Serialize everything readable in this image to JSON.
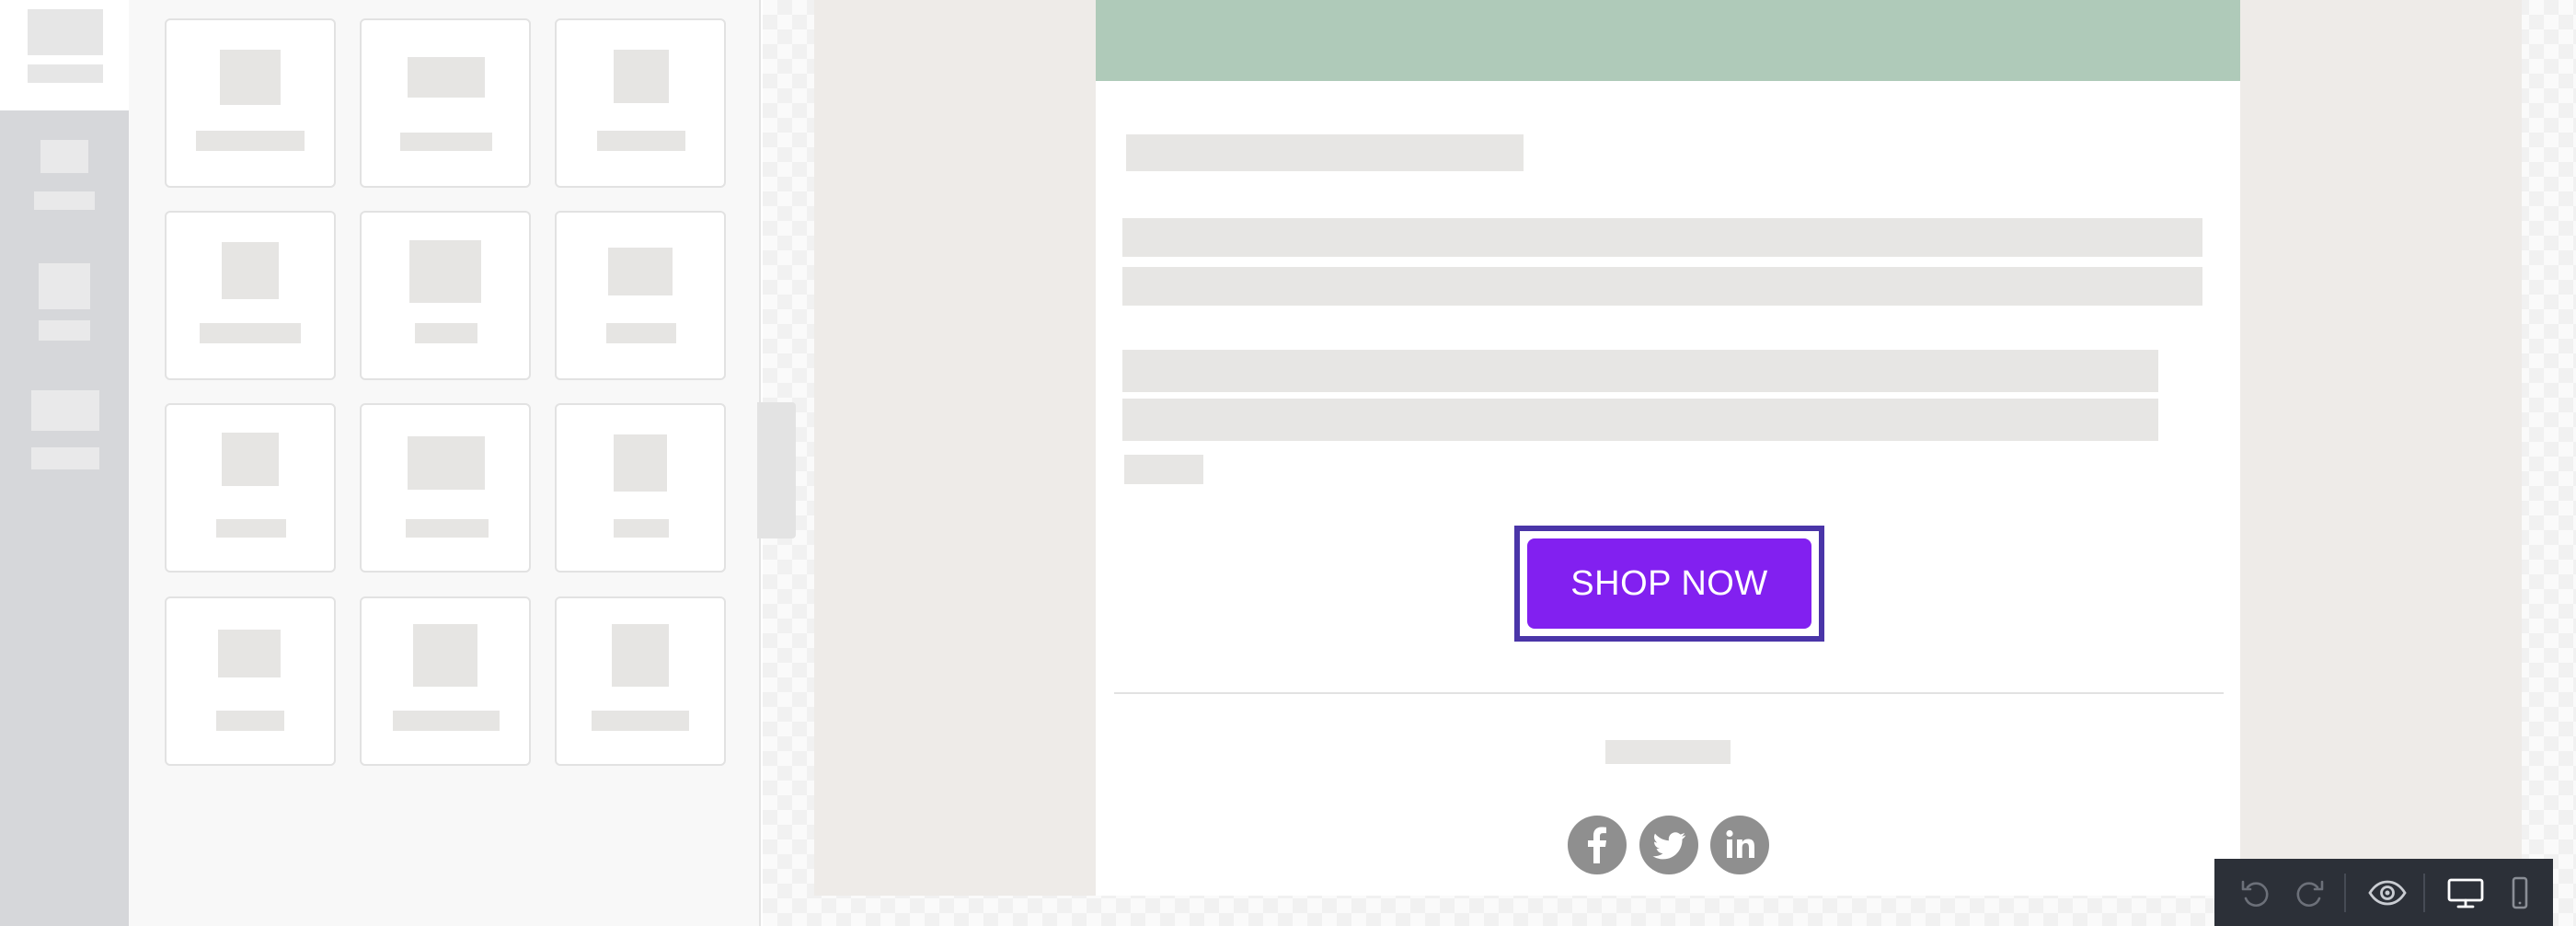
{
  "editor": {
    "sidebar_tabs": [
      "content-blocks",
      "rows",
      "settings",
      "saved-blocks"
    ],
    "active_tab": "content-blocks",
    "content_block_tile_count": 12
  },
  "email": {
    "header_color": "#afcab9",
    "cta": {
      "label": "SHOP NOW",
      "background": "#8220f0",
      "text_color": "#ffffff",
      "selected_outline": "#4a35a8"
    },
    "social_icons": [
      "facebook-icon",
      "twitter-icon",
      "linkedin-icon"
    ]
  },
  "toolbar": {
    "buttons": [
      "undo-icon",
      "redo-icon",
      "preview-eye-icon",
      "desktop-view-icon",
      "mobile-view-icon"
    ],
    "active_view": "desktop"
  }
}
